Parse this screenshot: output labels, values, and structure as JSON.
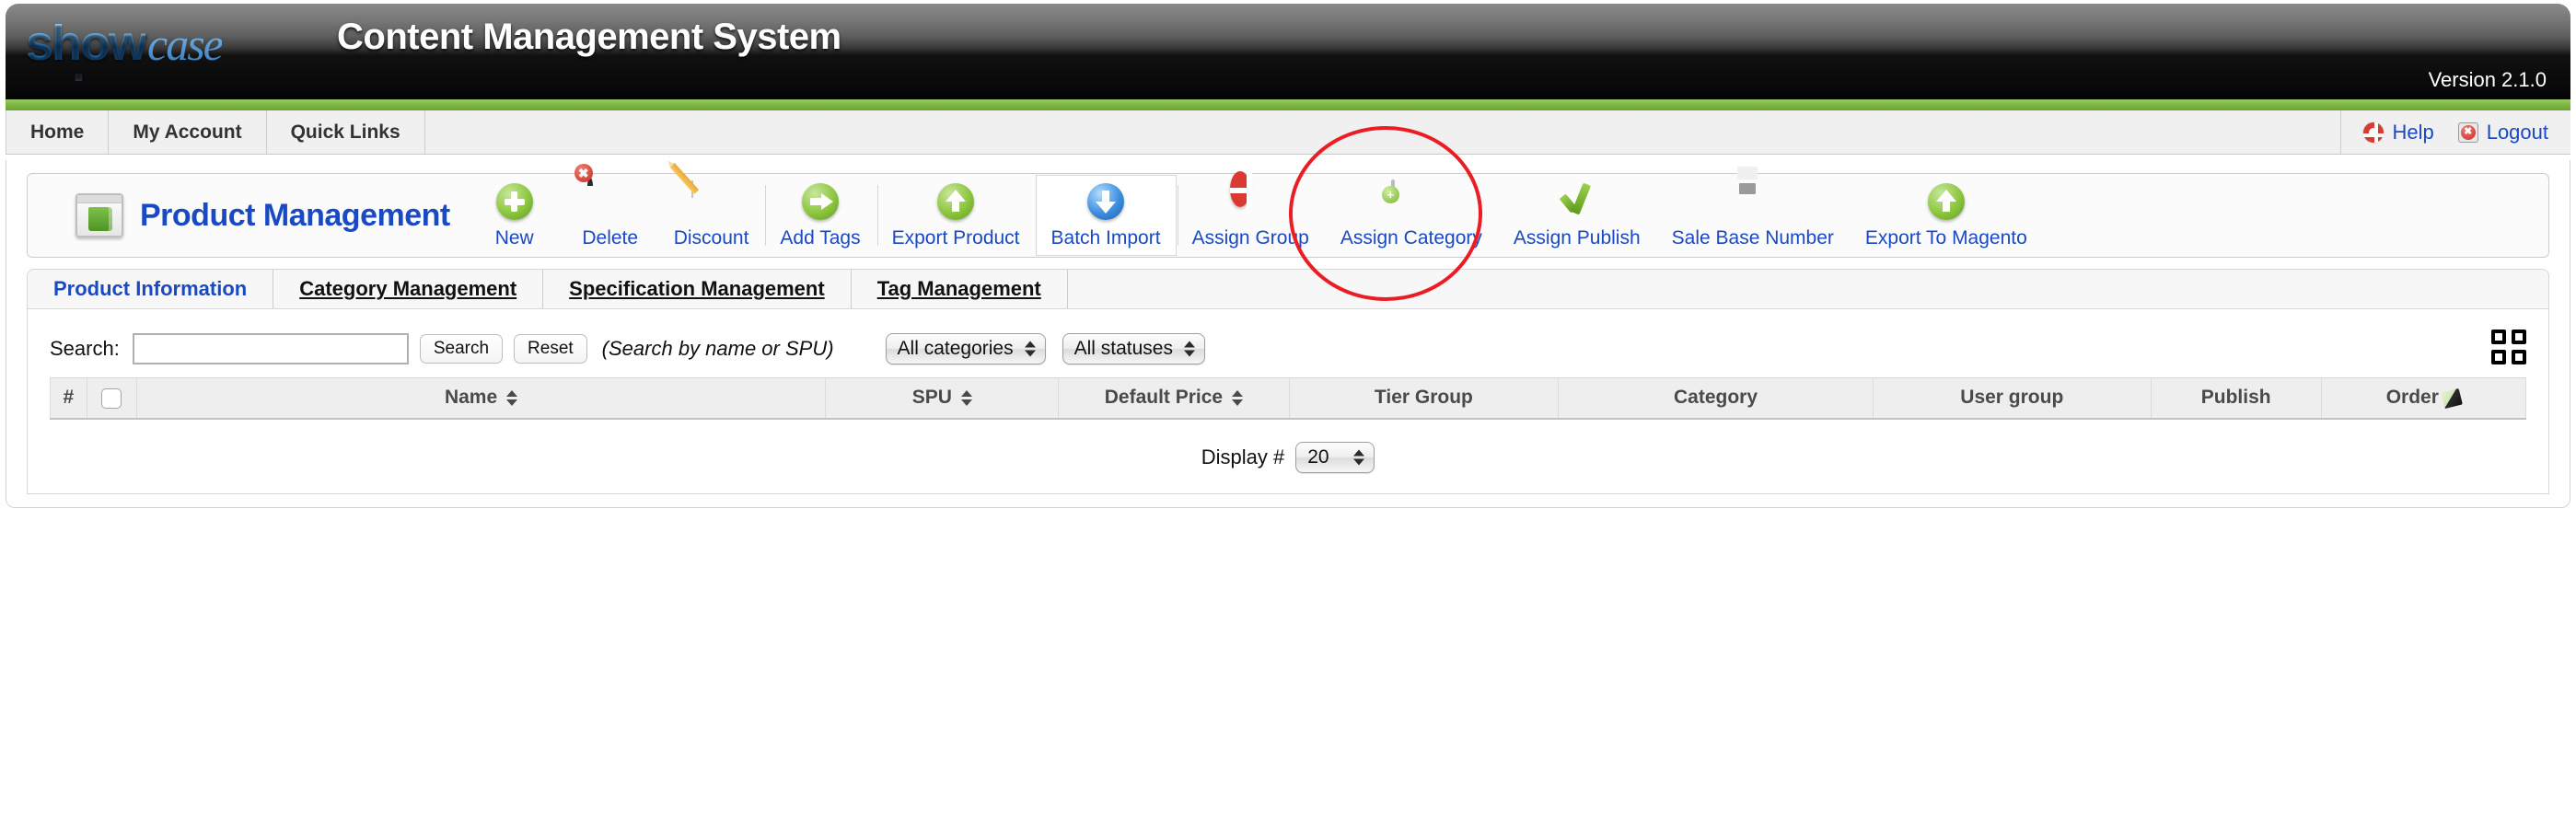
{
  "banner": {
    "logo_primary": "show",
    "logo_secondary": "case",
    "title": "Content Management System",
    "version": "Version 2.1.0"
  },
  "navbar": {
    "items": [
      {
        "label": "Home"
      },
      {
        "label": "My Account"
      },
      {
        "label": "Quick Links"
      }
    ],
    "right": [
      {
        "label": "Help",
        "icon": "lifebuoy-icon"
      },
      {
        "label": "Logout",
        "icon": "logout-icon"
      }
    ]
  },
  "toolbar": {
    "title": "Product Management",
    "title_icon": "folder-window-icon",
    "items": [
      {
        "label": "New",
        "icon": "green-plus-circle-icon"
      },
      {
        "label": "Delete",
        "icon": "trash-delete-icon"
      },
      {
        "label": "Discount",
        "icon": "document-pencil-icon"
      },
      {
        "label": "Add Tags",
        "icon": "green-arrow-right-circle-icon"
      },
      {
        "label": "Export Product",
        "icon": "green-arrow-up-circle-icon"
      },
      {
        "label": "Batch Import",
        "icon": "blue-arrow-down-circle-icon"
      },
      {
        "label": "Assign Group",
        "icon": "lifebuoy-icon"
      },
      {
        "label": "Assign Category",
        "icon": "window-plus-icon"
      },
      {
        "label": "Assign Publish",
        "icon": "green-check-icon"
      },
      {
        "label": "Sale Base Number",
        "icon": "floppy-disk-icon"
      },
      {
        "label": "Export To Magento",
        "icon": "green-arrow-up-circle-icon"
      }
    ],
    "highlighted_item": "Batch Import",
    "annotation_color": "#ec1c24",
    "annotation_target": "Batch Import"
  },
  "tabs": [
    {
      "label": "Product Information",
      "active": true
    },
    {
      "label": "Category Management",
      "active": false
    },
    {
      "label": "Specification Management",
      "active": false
    },
    {
      "label": "Tag Management",
      "active": false
    }
  ],
  "search": {
    "label": "Search:",
    "value": "",
    "placeholder": "",
    "search_button": "Search",
    "reset_button": "Reset",
    "hint": "(Search by name or SPU)",
    "category_filter": "All categories",
    "status_filter": "All statuses",
    "grid_icon": "grid-view-icon"
  },
  "table": {
    "columns": [
      {
        "label": "#",
        "sortable": false
      },
      {
        "label": "",
        "type": "checkbox"
      },
      {
        "label": "Name",
        "sortable": true
      },
      {
        "label": "SPU",
        "sortable": true
      },
      {
        "label": "Default Price",
        "sortable": true
      },
      {
        "label": "Tier Group",
        "sortable": false
      },
      {
        "label": "Category",
        "sortable": false
      },
      {
        "label": "User group",
        "sortable": false
      },
      {
        "label": "Publish",
        "sortable": false
      },
      {
        "label": "Order",
        "sortable": false,
        "icon": "order-save-icon"
      }
    ],
    "rows": []
  },
  "footer": {
    "display_label": "Display #",
    "display_value": "20"
  },
  "colors": {
    "link": "#1a49c4",
    "green_bar": "#7cb342",
    "annotation": "#ec1c24"
  }
}
